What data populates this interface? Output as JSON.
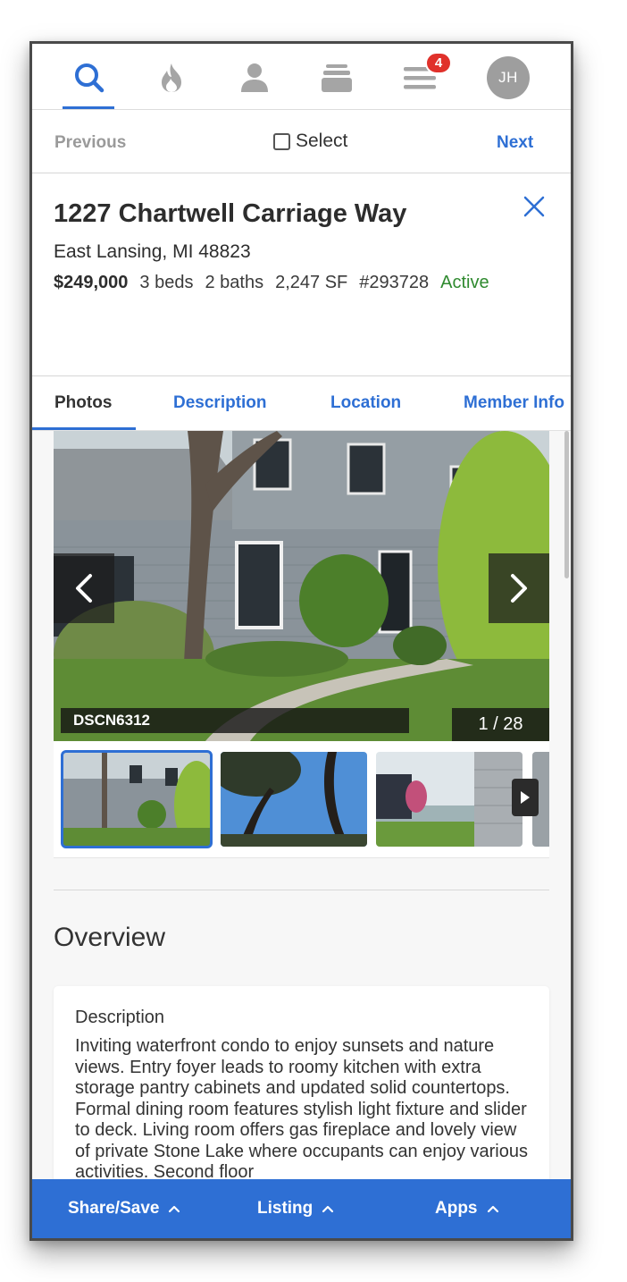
{
  "nav": {
    "badge_count": "4",
    "avatar_initials": "JH",
    "active_color": "#2e6fd4",
    "icons": [
      "search-icon",
      "flame-icon",
      "person-icon",
      "stack-icon",
      "menu-icon"
    ]
  },
  "pager": {
    "previous_label": "Previous",
    "select_label": "Select",
    "next_label": "Next"
  },
  "listing": {
    "address": "1227 Chartwell Carriage Way",
    "city_line": "East Lansing, MI 48823",
    "price": "$249,000",
    "beds": "3 beds",
    "baths": "2 baths",
    "size": "2,247 SF",
    "mls_number": "#293728",
    "status": "Active",
    "status_color": "#2f8a2f"
  },
  "tabs": [
    {
      "label": "Photos"
    },
    {
      "label": "Description"
    },
    {
      "label": "Location"
    },
    {
      "label": "Member Info"
    }
  ],
  "gallery": {
    "caption": "DSCN6312",
    "counter": "1 / 28"
  },
  "overview": {
    "title": "Overview",
    "description_label": "Description",
    "description_text": "Inviting waterfront condo to enjoy sunsets and nature views. Entry foyer leads to roomy kitchen with extra storage pantry cabinets and updated solid countertops. Formal dining room features stylish light fixture and slider to deck. Living room offers gas fireplace and lovely view of private Stone Lake where occupants can enjoy various activities. Second floor"
  },
  "bottom_bar": {
    "share_label": "Share/Save",
    "listing_label": "Listing",
    "apps_label": "Apps"
  }
}
